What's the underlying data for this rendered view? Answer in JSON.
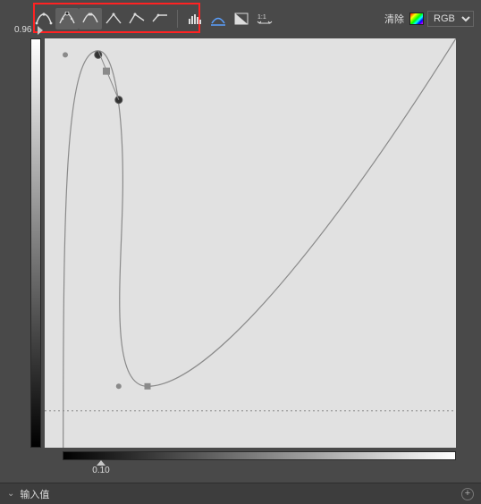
{
  "toolbar": {
    "tools": [
      {
        "name": "curve-smooth-icon",
        "selected": false
      },
      {
        "name": "curve-point-icon",
        "selected": true
      },
      {
        "name": "curve-cut-icon",
        "selected": true
      },
      {
        "name": "curve-linear1-icon",
        "selected": false
      },
      {
        "name": "curve-linear2-icon",
        "selected": false
      },
      {
        "name": "curve-flat-icon",
        "selected": false
      }
    ],
    "extras": [
      {
        "name": "histogram-icon"
      },
      {
        "name": "gradient-tool-icon"
      },
      {
        "name": "invert-icon"
      },
      {
        "name": "reset-icon"
      }
    ],
    "clear_label": "清除",
    "channel": "RGB"
  },
  "axes": {
    "y_value": "0.96",
    "x_value": "0.10",
    "x_marker_left": 113
  },
  "chart_data": {
    "type": "line",
    "title": "",
    "xlabel": "",
    "ylabel": "",
    "xlim": [
      0,
      1
    ],
    "ylim": [
      0,
      1
    ],
    "control_points": [
      {
        "x": 0.0,
        "y": 0.0,
        "kind": "endpoint"
      },
      {
        "x": 0.05,
        "y": 0.96,
        "kind": "anchor"
      },
      {
        "x": 0.13,
        "y": 0.96,
        "kind": "smooth"
      },
      {
        "x": 0.15,
        "y": 0.92,
        "kind": "square-selected"
      },
      {
        "x": 0.18,
        "y": 0.85,
        "kind": "smooth"
      },
      {
        "x": 0.18,
        "y": 0.15,
        "kind": "anchor"
      },
      {
        "x": 0.25,
        "y": 0.15,
        "kind": "square"
      },
      {
        "x": 1.0,
        "y": 1.0,
        "kind": "endpoint"
      }
    ],
    "baseline_y": 0.09
  },
  "footer": {
    "label": "输入值"
  }
}
